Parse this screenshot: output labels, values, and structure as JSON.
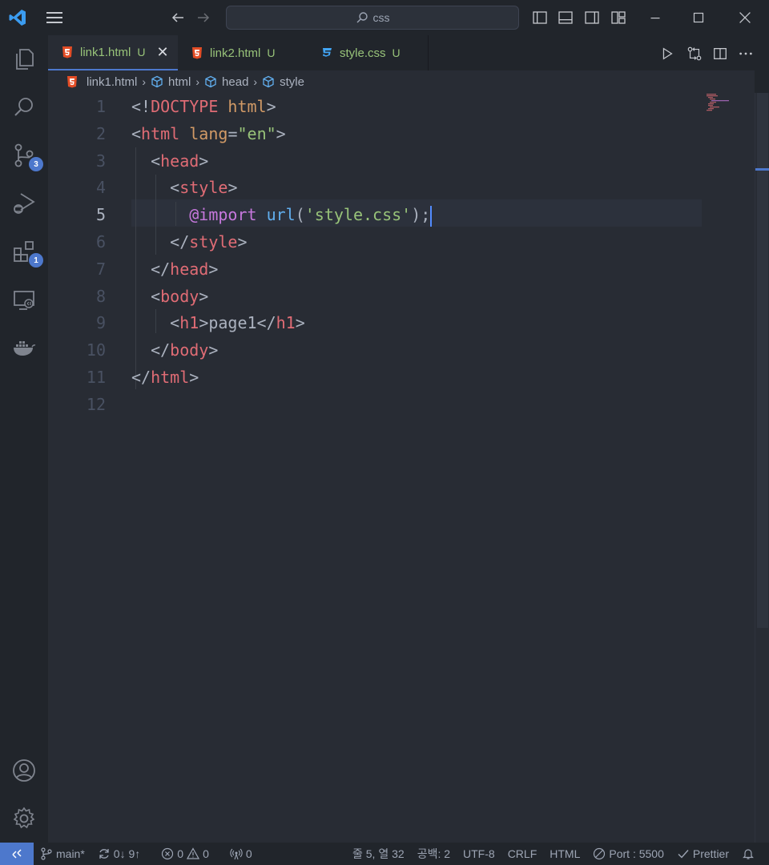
{
  "titlebar": {
    "search": "css"
  },
  "activity": {
    "scm_badge": "3",
    "extensions_badge": "1"
  },
  "tabs": [
    {
      "name": "link1.html",
      "git": "U",
      "close": "✕",
      "type": "html"
    },
    {
      "name": "link2.html",
      "git": "U",
      "type": "html"
    },
    {
      "name": "style.css",
      "git": "U",
      "type": "css"
    }
  ],
  "breadcrumbs": [
    "link1.html",
    "html",
    "head",
    "style"
  ],
  "editor": {
    "line_numbers": [
      "1",
      "2",
      "3",
      "4",
      "5",
      "6",
      "7",
      "8",
      "9",
      "10",
      "11",
      "12"
    ],
    "current_line": 5,
    "lines": [
      [
        [
          "<!",
          "p"
        ],
        [
          "DOCTYPE",
          "t"
        ],
        [
          " html",
          "a"
        ],
        [
          ">",
          "p"
        ]
      ],
      [
        [
          "<",
          "p"
        ],
        [
          "html",
          "t"
        ],
        [
          " lang",
          "a"
        ],
        [
          "=",
          "p"
        ],
        [
          "\"en\"",
          "s"
        ],
        [
          ">",
          "p"
        ]
      ],
      [
        [
          "  <",
          "p"
        ],
        [
          "head",
          "t"
        ],
        [
          ">",
          "p"
        ]
      ],
      [
        [
          "    <",
          "p"
        ],
        [
          "style",
          "t"
        ],
        [
          ">",
          "p"
        ]
      ],
      [
        [
          "      ",
          "p"
        ],
        [
          "@import",
          "k"
        ],
        [
          " ",
          "p"
        ],
        [
          "url",
          "f"
        ],
        [
          "(",
          "p"
        ],
        [
          "'style.css'",
          "q"
        ],
        [
          ");",
          "p"
        ]
      ],
      [
        [
          "    </",
          "p"
        ],
        [
          "style",
          "t"
        ],
        [
          ">",
          "p"
        ]
      ],
      [
        [
          "  </",
          "p"
        ],
        [
          "head",
          "t"
        ],
        [
          ">",
          "p"
        ]
      ],
      [
        [
          "  <",
          "p"
        ],
        [
          "body",
          "t"
        ],
        [
          ">",
          "p"
        ]
      ],
      [
        [
          "    <",
          "p"
        ],
        [
          "h1",
          "t"
        ],
        [
          ">page1</",
          "p"
        ],
        [
          "h1",
          "t"
        ],
        [
          ">",
          "p"
        ]
      ],
      [
        [
          "  </",
          "p"
        ],
        [
          "body",
          "t"
        ],
        [
          ">",
          "p"
        ]
      ],
      [
        [
          "</",
          "p"
        ],
        [
          "html",
          "t"
        ],
        [
          ">",
          "p"
        ]
      ],
      []
    ]
  },
  "status": {
    "branch": "main*",
    "sync": "0↓ 9↑",
    "errors": "0",
    "warnings": "0",
    "ports": "0",
    "position": "줄 5, 열 32",
    "spaces": "공백: 2",
    "encoding": "UTF-8",
    "eol": "CRLF",
    "language": "HTML",
    "live_server": "Port : 5500",
    "prettier": "Prettier"
  }
}
